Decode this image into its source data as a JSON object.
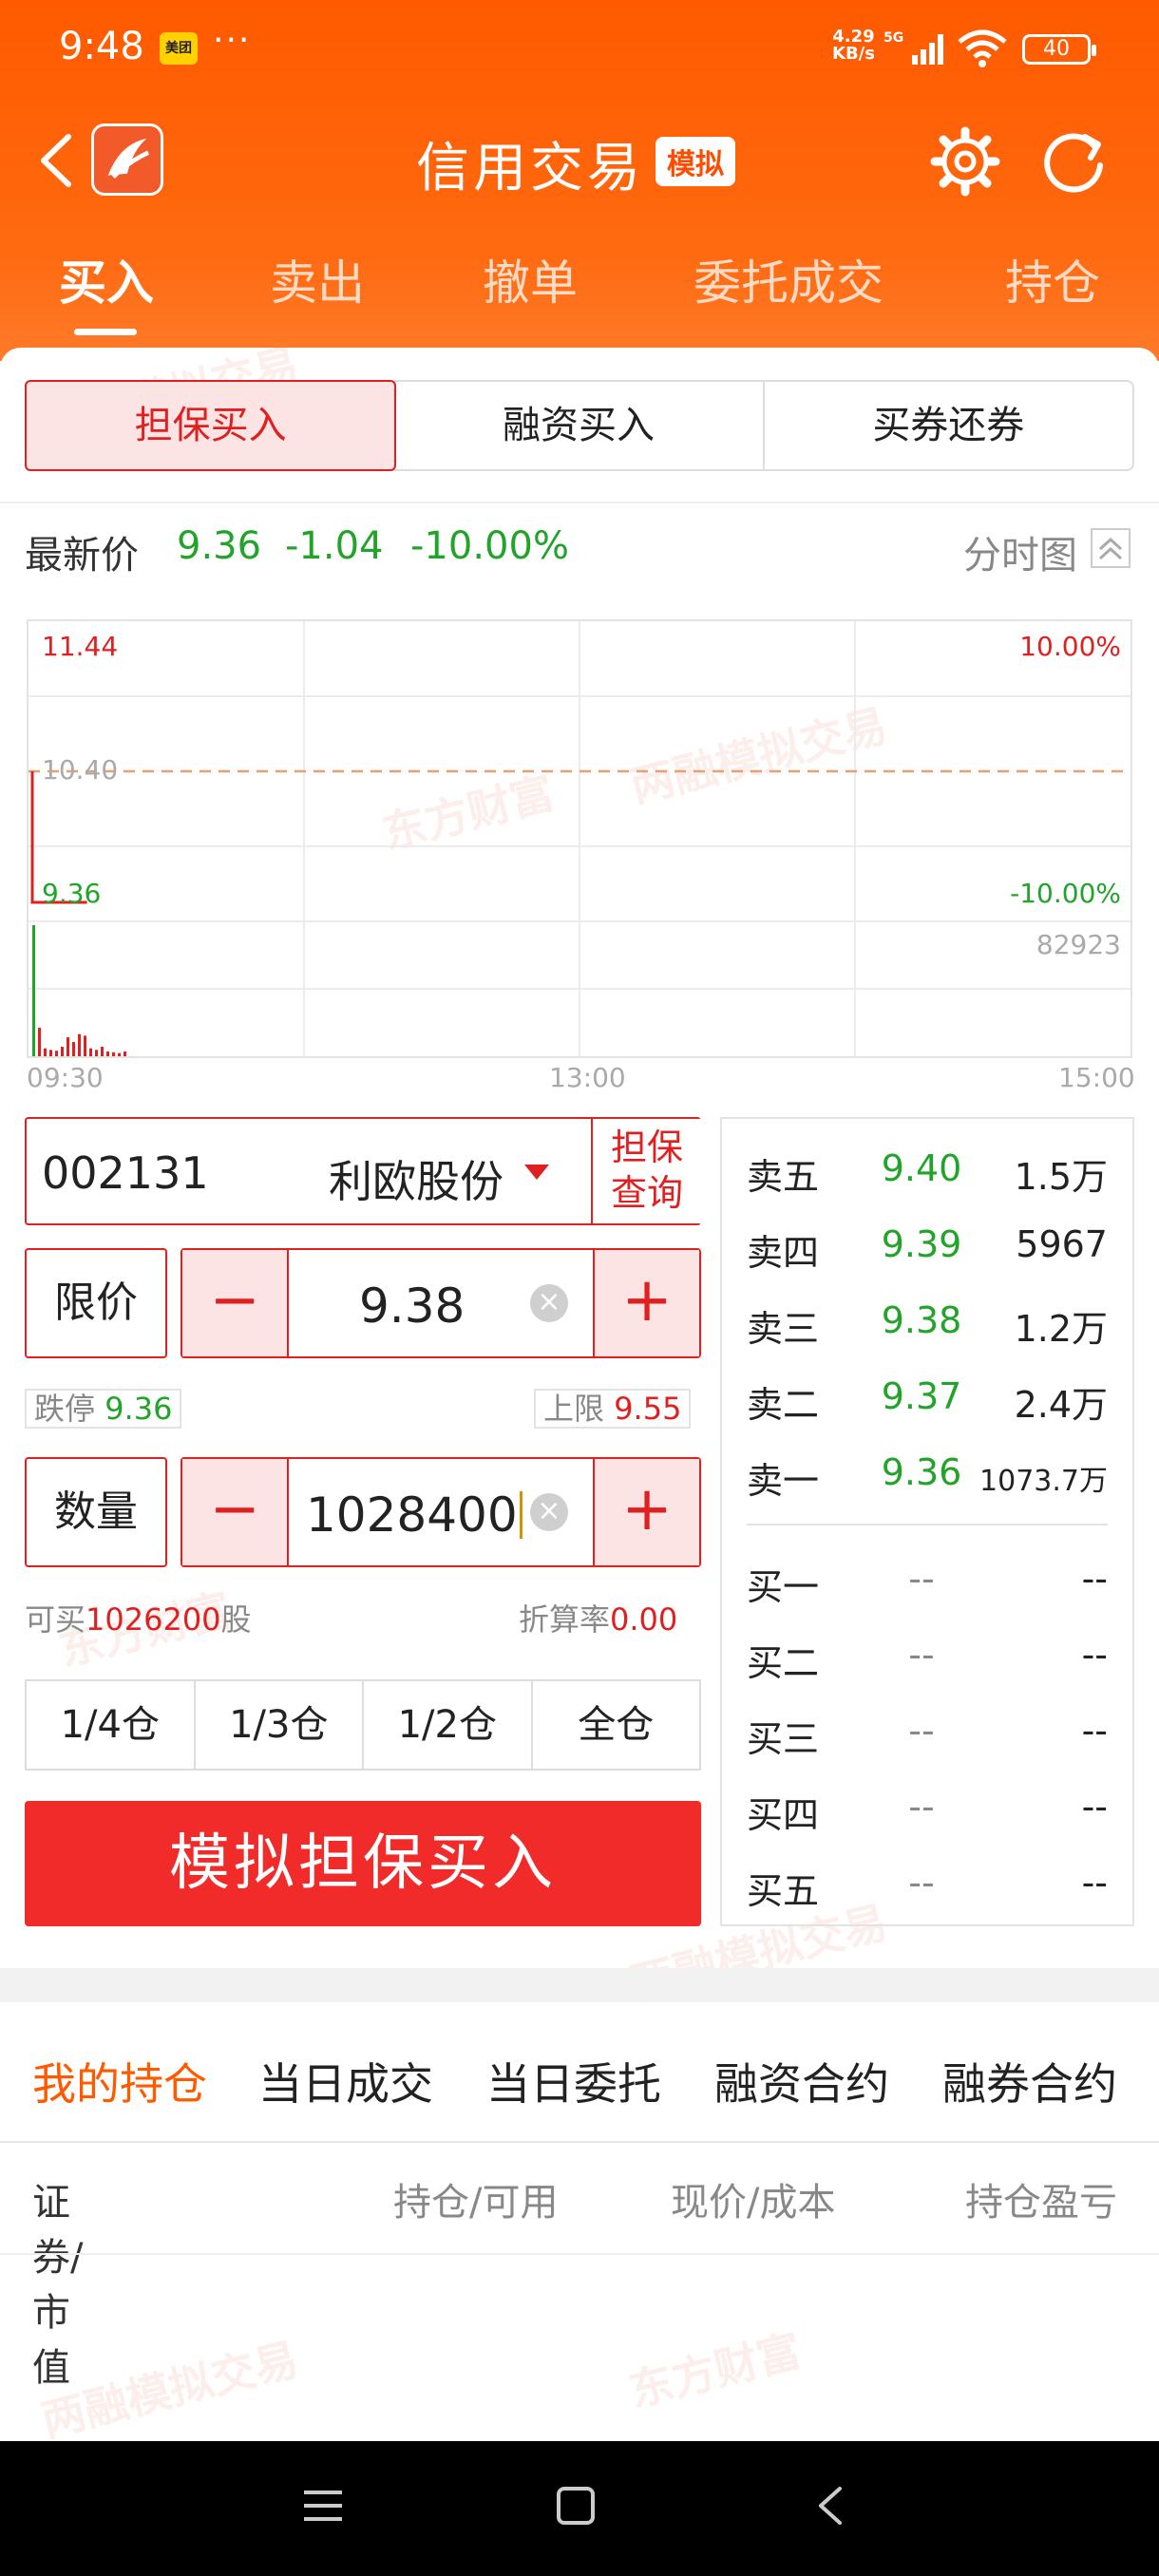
{
  "status_bar": {
    "time": "9:48",
    "notification_app": "美团",
    "more": "···",
    "net_speed": "4.29\nKB/s",
    "net_type": "5G",
    "battery": "40"
  },
  "header": {
    "title": "信用交易",
    "badge": "模拟"
  },
  "tabs": [
    "买入",
    "卖出",
    "撤单",
    "委托成交",
    "持仓"
  ],
  "segments": [
    "担保买入",
    "融资买入",
    "买券还券"
  ],
  "quote": {
    "label": "最新价",
    "price": "9.36",
    "change": "-1.04",
    "change_pct": "-10.00%",
    "chart_toggle": "分时图"
  },
  "chart_data": {
    "type": "line",
    "x_ticks": [
      "09:30",
      "13:00",
      "15:00"
    ],
    "y_high": "11.44",
    "y_mid": "10.40",
    "y_low": "9.36",
    "pct_high": "10.00%",
    "pct_low": "-10.00%",
    "volume_max": "82923",
    "ylim": [
      9.36,
      11.44
    ],
    "prev_close": 10.4,
    "price_series": [
      {
        "t": "09:30",
        "price": 10.4
      },
      {
        "t": "09:30",
        "price": 9.36
      },
      {
        "t": "09:42",
        "price": 9.36
      }
    ],
    "volume_bars": [
      82923,
      18000,
      5000,
      4000,
      3500,
      6000,
      12000,
      9000,
      14000,
      13000,
      5000,
      4000,
      6000,
      3000,
      2500,
      2000,
      3000
    ]
  },
  "order": {
    "code": "002131",
    "name": "利欧股份",
    "guarantee_query": "担保\n查询",
    "price_mode": "限价",
    "price": "9.38",
    "limit_down_label": "跌停",
    "limit_down": "9.36",
    "limit_up_label": "上限",
    "limit_up": "9.55",
    "qty_label": "数量",
    "quantity": "1028400",
    "avail_label": "可买",
    "avail_qty": "1026200",
    "avail_unit": "股",
    "ratio_label": "折算率",
    "ratio": "0.00",
    "positions": [
      "1/4仓",
      "1/3仓",
      "1/2仓",
      "全仓"
    ],
    "submit_label": "模拟担保买入",
    "minus": "−",
    "plus": "+",
    "clear": "×"
  },
  "order_book": {
    "asks": [
      {
        "label": "卖五",
        "price": "9.40",
        "volume": "1.5万"
      },
      {
        "label": "卖四",
        "price": "9.39",
        "volume": "5967"
      },
      {
        "label": "卖三",
        "price": "9.38",
        "volume": "1.2万"
      },
      {
        "label": "卖二",
        "price": "9.37",
        "volume": "2.4万"
      },
      {
        "label": "卖一",
        "price": "9.36",
        "volume": "1073.7万"
      }
    ],
    "bids": [
      {
        "label": "买一",
        "price": "--",
        "volume": "--"
      },
      {
        "label": "买二",
        "price": "--",
        "volume": "--"
      },
      {
        "label": "买三",
        "price": "--",
        "volume": "--"
      },
      {
        "label": "买四",
        "price": "--",
        "volume": "--"
      },
      {
        "label": "买五",
        "price": "--",
        "volume": "--"
      }
    ]
  },
  "bottom_tabs": [
    "我的持仓",
    "当日成交",
    "当日委托",
    "融资合约",
    "融券合约"
  ],
  "columns": [
    "证券/市值",
    "持仓/可用",
    "现价/成本",
    "持仓盈亏"
  ],
  "watermarks": [
    "两融模拟交易",
    "东方财富"
  ],
  "colors": {
    "brand_orange": "#ff5a00",
    "up_red": "#e02020",
    "down_green": "#22a32a"
  }
}
